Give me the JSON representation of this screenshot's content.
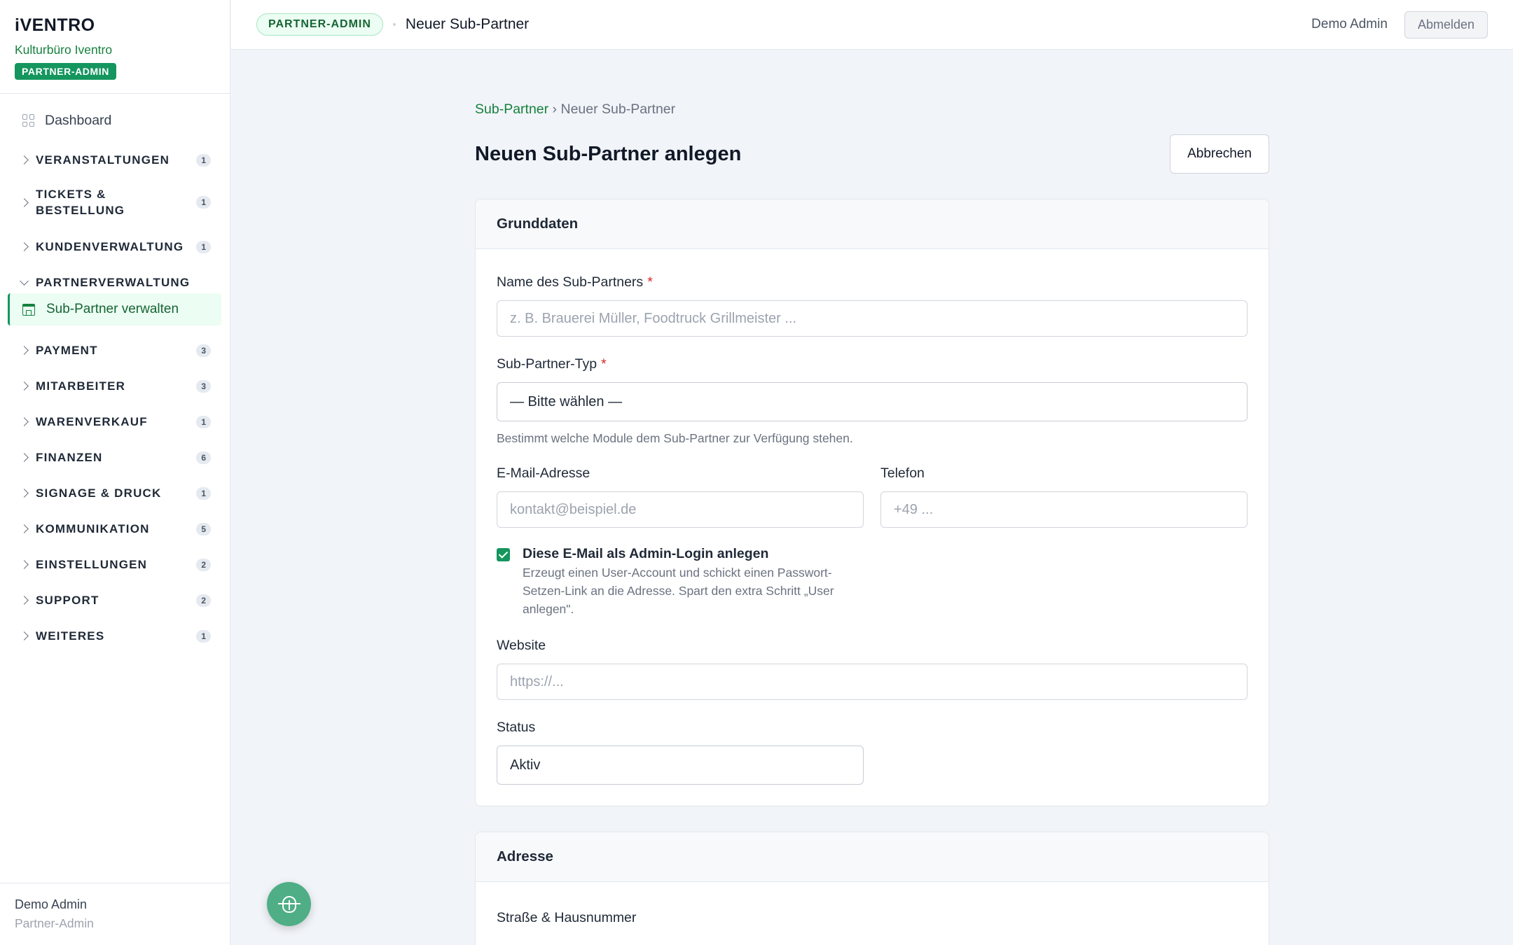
{
  "brand": {
    "logo": "iVENTRO",
    "org": "Kulturbüro Iventro",
    "badge": "PARTNER-ADMIN"
  },
  "nav": {
    "dashboard": "Dashboard",
    "groups": [
      {
        "label": "VERANSTALTUNGEN",
        "count": "1"
      },
      {
        "label": "TICKETS & BESTELLUNG",
        "count": "1"
      },
      {
        "label": "KUNDENVERWALTUNG",
        "count": "1"
      },
      {
        "label": "PARTNERVERWALTUNG",
        "count": ""
      },
      {
        "label": "PAYMENT",
        "count": "3"
      },
      {
        "label": "MITARBEITER",
        "count": "3"
      },
      {
        "label": "WARENVERKAUF",
        "count": "1"
      },
      {
        "label": "FINANZEN",
        "count": "6"
      },
      {
        "label": "SIGNAGE & DRUCK",
        "count": "1"
      },
      {
        "label": "KOMMUNIKATION",
        "count": "5"
      },
      {
        "label": "EINSTELLUNGEN",
        "count": "2"
      },
      {
        "label": "SUPPORT",
        "count": "2"
      },
      {
        "label": "WEITERES",
        "count": "1"
      }
    ],
    "active_item": "Sub-Partner verwalten"
  },
  "footer": {
    "user": "Demo Admin",
    "role": "Partner-Admin"
  },
  "topbar": {
    "role_pill": "PARTNER-ADMIN",
    "title": "Neuer Sub-Partner",
    "user": "Demo Admin",
    "logout": "Abmelden"
  },
  "breadcrumb": {
    "parent": "Sub-Partner",
    "sep": " › ",
    "current": "Neuer Sub-Partner"
  },
  "page": {
    "title": "Neuen Sub-Partner anlegen",
    "cancel": "Abbrechen"
  },
  "grunddaten": {
    "title": "Grunddaten",
    "name_label": "Name des Sub-Partners",
    "name_placeholder": "z. B. Brauerei Müller, Foodtruck Grillmeister ...",
    "type_label": "Sub-Partner-Typ",
    "type_value": "— Bitte wählen —",
    "type_hint": "Bestimmt welche Module dem Sub-Partner zur Verfügung stehen.",
    "email_label": "E-Mail-Adresse",
    "email_placeholder": "kontakt@beispiel.de",
    "phone_label": "Telefon",
    "phone_placeholder": "+49 ...",
    "admin_login_title": "Diese E-Mail als Admin-Login anlegen",
    "admin_login_desc": "Erzeugt einen User-Account und schickt einen Passwort-Setzen-Link an die Adresse. Spart den extra Schritt „User anlegen\".",
    "website_label": "Website",
    "website_placeholder": "https://...",
    "status_label": "Status",
    "status_value": "Aktiv"
  },
  "adresse": {
    "title": "Adresse",
    "street_label": "Straße & Hausnummer"
  },
  "required_mark": "*",
  "colors": {
    "accent": "#15965f",
    "accent_dark": "#15803d",
    "required": "#dc2626"
  }
}
